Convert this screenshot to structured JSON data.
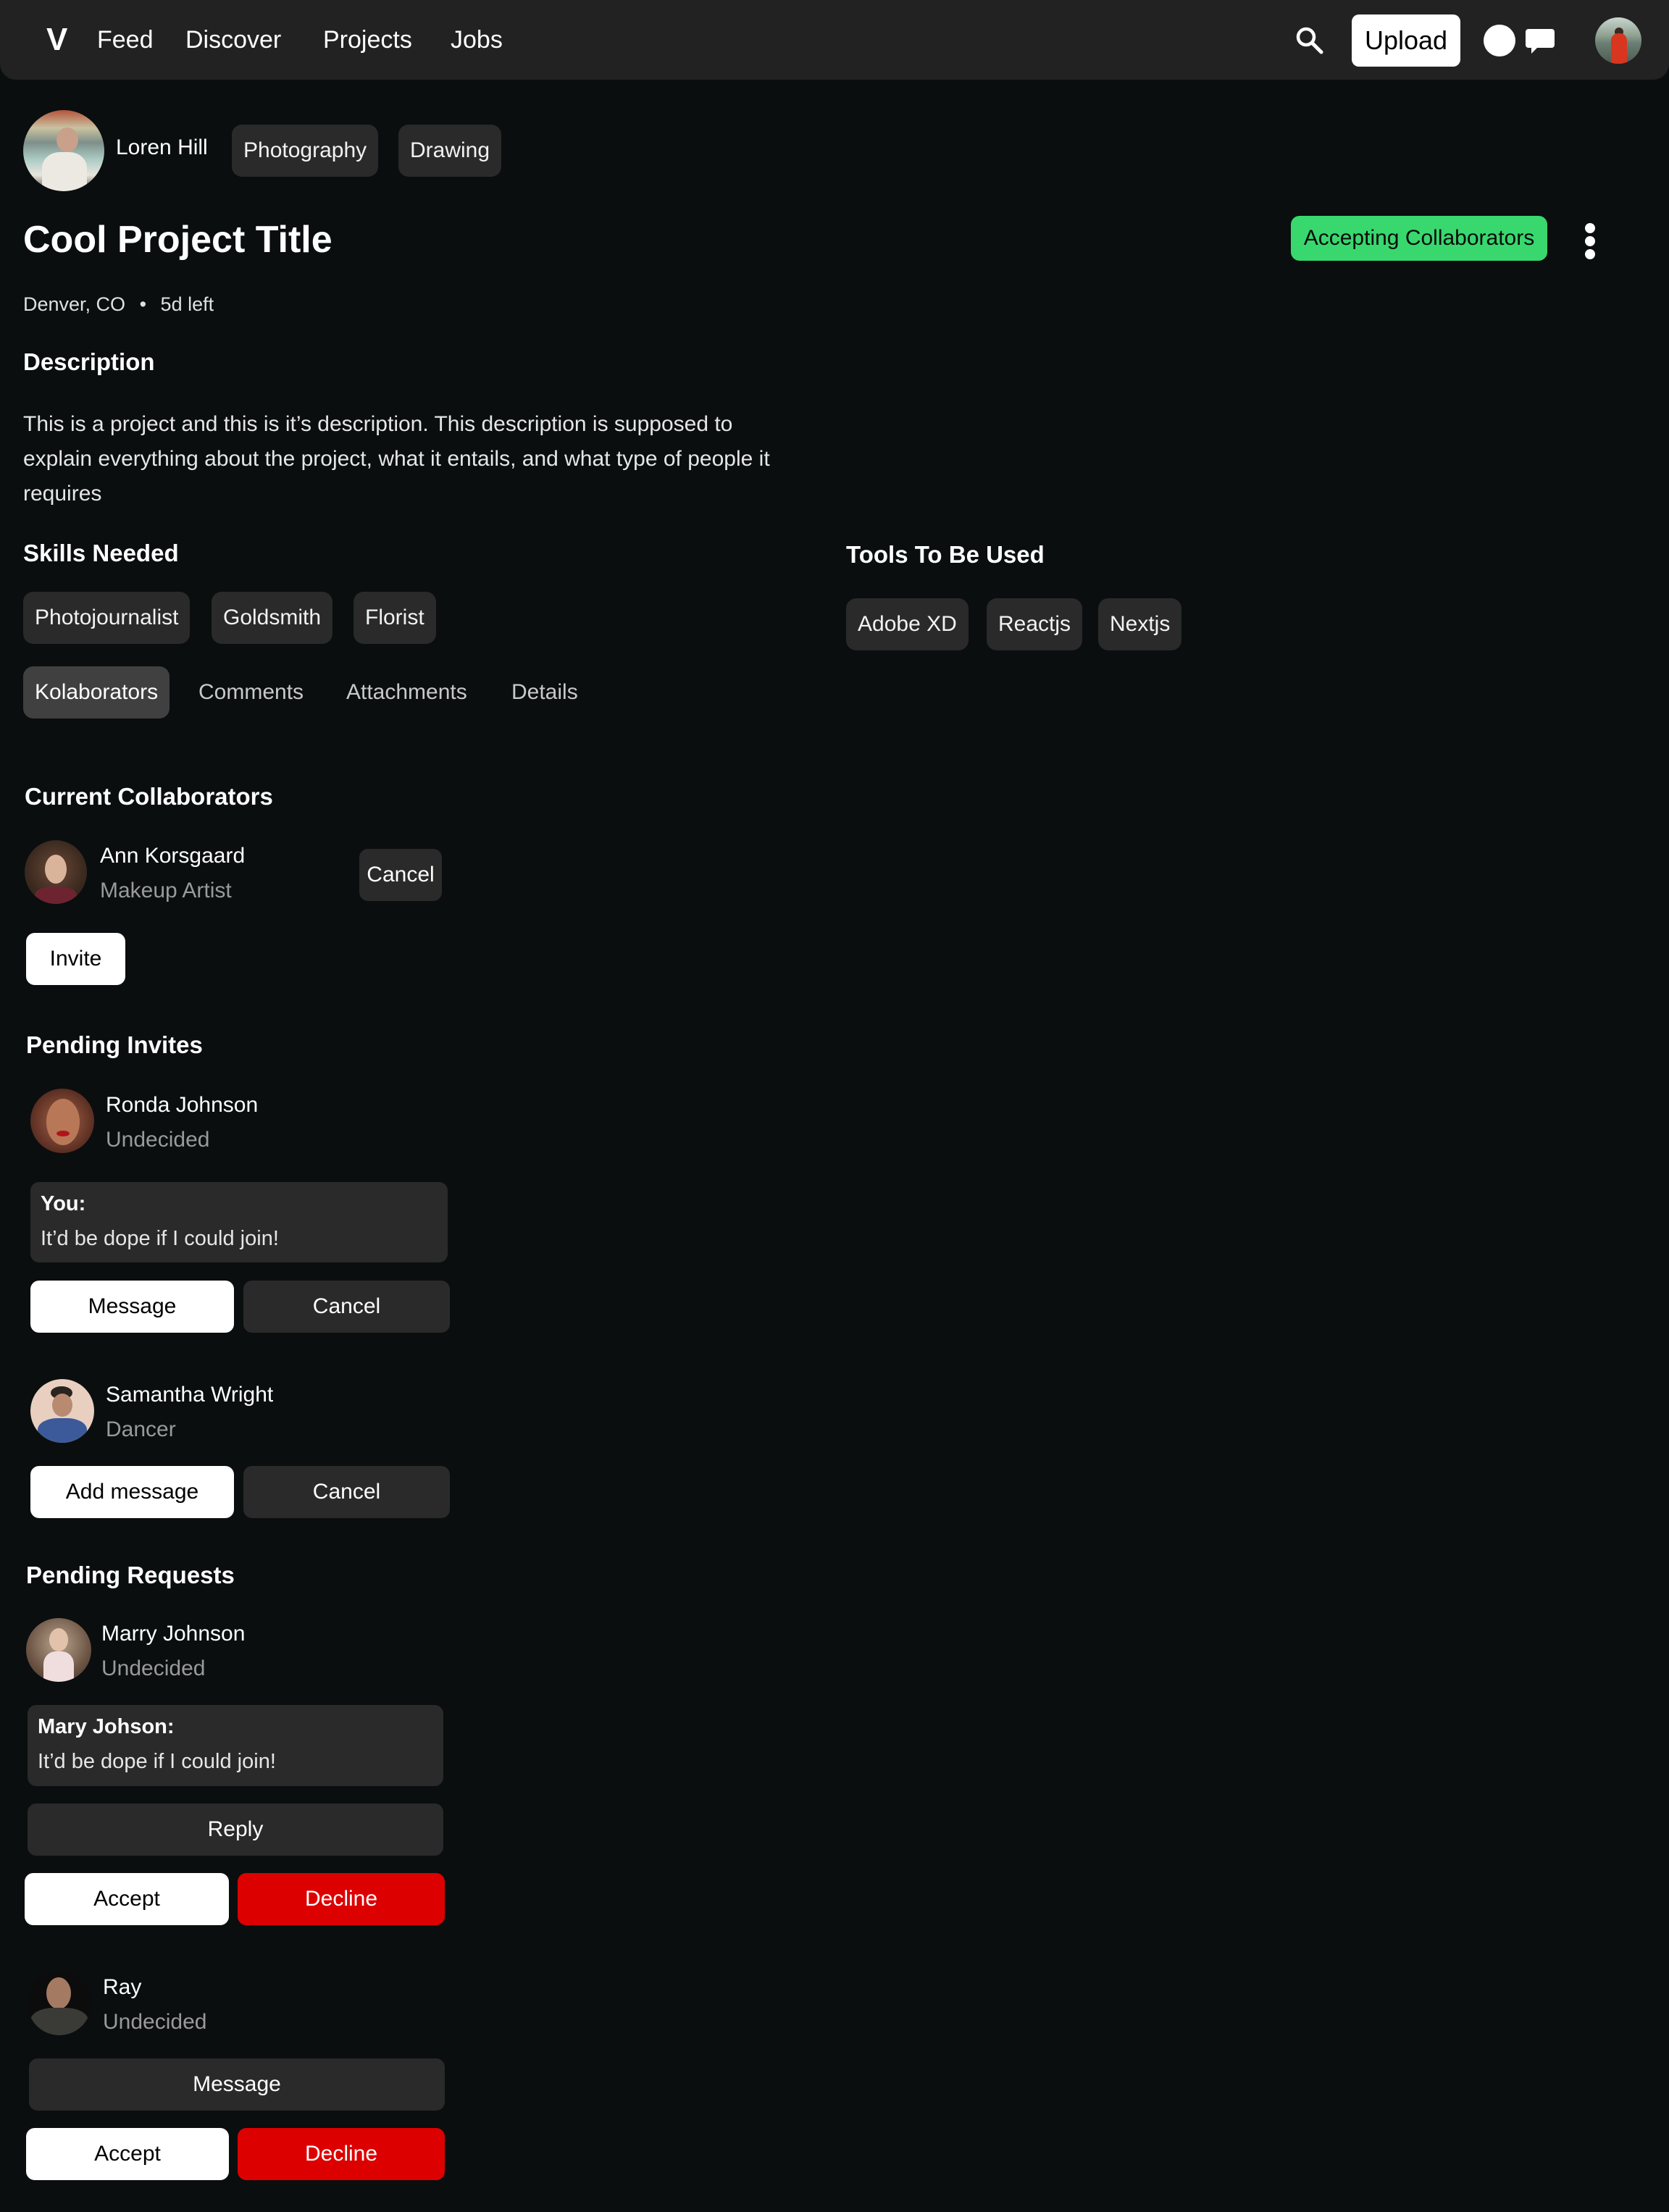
{
  "nav": {
    "logo": "V",
    "links": [
      "Feed",
      "Discover",
      "Projects",
      "Jobs"
    ],
    "upload_label": "Upload",
    "icons": [
      "search-icon",
      "notification-icon",
      "chat-icon",
      "profile-avatar"
    ]
  },
  "project": {
    "owner": "Loren Hill",
    "categories": [
      "Photography",
      "Drawing"
    ],
    "title": "Cool Project Title",
    "status": "Accepting Collaborators",
    "status_color": "#38d86e",
    "location": "Denver, CO",
    "separator": "•",
    "time_left": "5d left",
    "description_heading": "Description",
    "description": "This is a project and this is it’s description. This description is supposed to explain everything about the project, what it entails, and what type of people it requires",
    "skills_heading": "Skills Needed",
    "skills": [
      "Photojournalist",
      "Goldsmith",
      "Florist"
    ],
    "tools_heading": "Tools To Be Used",
    "tools": [
      "Adobe XD",
      "Reactjs",
      "Nextjs"
    ]
  },
  "tabs": [
    {
      "label": "Kolaborators",
      "active": true
    },
    {
      "label": "Comments",
      "active": false
    },
    {
      "label": "Attachments",
      "active": false
    },
    {
      "label": "Details",
      "active": false
    }
  ],
  "current": {
    "heading": "Current Collaborators",
    "people": [
      {
        "name": "Ann Korsgaard",
        "role": "Makeup Artist",
        "action": "Cancel"
      }
    ],
    "invite_label": "Invite"
  },
  "invites": {
    "heading": "Pending Invites",
    "people": [
      {
        "name": "Ronda Johnson",
        "role": "Undecided",
        "message_author": "You:",
        "message": "It’d be dope if I could join!",
        "primary": "Message",
        "secondary": "Cancel"
      },
      {
        "name": "Samantha Wright",
        "role": "Dancer",
        "primary": "Add message",
        "secondary": "Cancel"
      }
    ]
  },
  "requests": {
    "heading": "Pending Requests",
    "people": [
      {
        "name": "Marry Johnson",
        "role": "Undecided",
        "message_author": "Mary Johson:",
        "message": "It’d be dope if I could join!",
        "secondary_action": "Reply",
        "accept": "Accept",
        "decline": "Decline"
      },
      {
        "name": "Ray",
        "role": "Undecided",
        "secondary_action": "Message",
        "accept": "Accept",
        "decline": "Decline"
      }
    ]
  },
  "colors": {
    "background": "#0a0e0f",
    "nav": "#222222",
    "chip": "#2a2a2a",
    "active_tab": "#404040",
    "decline": "#dd0000",
    "accept_badge": "#38d86e"
  }
}
